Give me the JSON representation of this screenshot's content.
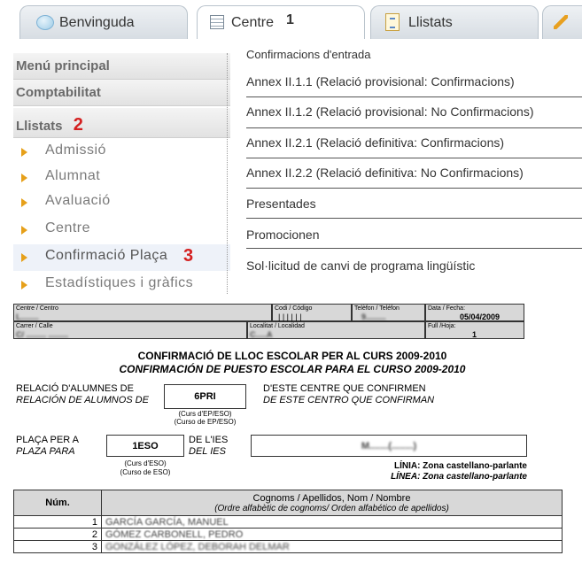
{
  "tabs": [
    {
      "label": "Benvinguda",
      "icon": "chat-bubble-icon"
    },
    {
      "label": "Centre",
      "icon": "grid-icon",
      "annotation": "1"
    },
    {
      "label": "Llistats",
      "icon": "list-icon"
    }
  ],
  "sidebar": {
    "sections": [
      "Menú principal",
      "Comptabilitat"
    ],
    "active_section": "Llistats",
    "active_annotation": "2",
    "items": [
      "Admissió",
      "Alumnat",
      "Avaluació",
      "Centre",
      "Confirmació Plaça",
      "Estadístiques i gràfics"
    ],
    "highlight_annotation": "3"
  },
  "menu": {
    "heading": "Confirmacions d'entrada",
    "items": [
      "Annex II.1.1 (Relació provisional: Confirmacions)",
      "Annex II.1.2 (Relació provisional: No Confirmacions)",
      "Annex II.2.1 (Relació definitiva: Confirmacions)",
      "Annex II.2.2 (Relació definitiva: No Confirmacions)",
      "Presentades",
      "Promocionen",
      "Sol·licitud de canvi de programa lingüístic"
    ]
  },
  "doc": {
    "centre_label": "Centre / Centro",
    "centre_value": "L........",
    "codi_label": "Codi / Código",
    "codi_value": "| | | | | |",
    "telefon_label": "Telèfon / Teléfon",
    "telefon_value": "9.........",
    "data_label": "Data / Fecha:",
    "data_value": "05/04/2009",
    "carrer_label": "Carrer / Calle",
    "carrer_value": "C/ ......... .........",
    "localitat_label": "Localitat / Localidad",
    "localitat_value": "C.....A",
    "full_label": "Full /Hoja:",
    "full_value": "1",
    "title_val": "CONFIRMACIÓ DE LLOC ESCOLAR PER AL CURS 2009-2010",
    "title_es": "CONFIRMACIÓN DE PUESTO ESCOLAR PARA EL CURSO 2009-2010",
    "relacio_val": "RELACIÓ D'ALUMNES DE",
    "relacio_es": "RELACIÓN DE ALUMNOS DE",
    "curs_origen": "6PRI",
    "curs_origen_note1": "(Curs d'EP/ESO)",
    "curs_origen_note2": "(Curso de EP/ESO)",
    "confirmen_val": "D'ESTE CENTRE QUE CONFIRMEN",
    "confirmen_es": "DE ESTE CENTRO QUE CONFIRMAN",
    "placa_val": "PLAÇA PER A",
    "placa_es": "PLAZA PARA",
    "curs_desti": "1ESO",
    "curs_desti_note1": "(Curs d'ESO)",
    "curs_desti_note2": "(Curso de ESO)",
    "ies_val": "DE L'IES",
    "ies_es": "DEL IES",
    "ies_name": "M.......(........)",
    "linia_val": "LÍNIA:  Zona castellano-parlante",
    "linia_es": "LÍNEA: Zona castellano-parlante",
    "table_header_num": "Núm.",
    "table_header_names": "Cognoms / Apellidos, Nom / Nombre",
    "table_header_order": "(Ordre alfabètic de cognoms/ Orden alfabético de apellidos)",
    "rows": [
      {
        "num": "1",
        "name": "GARCÍA GARCÍA, MANUEL"
      },
      {
        "num": "2",
        "name": "GÓMEZ CARBONELL, PEDRO"
      },
      {
        "num": "3",
        "name": "GONZÁLEZ LÓPEZ, DEBORAH DELMAR"
      }
    ]
  }
}
